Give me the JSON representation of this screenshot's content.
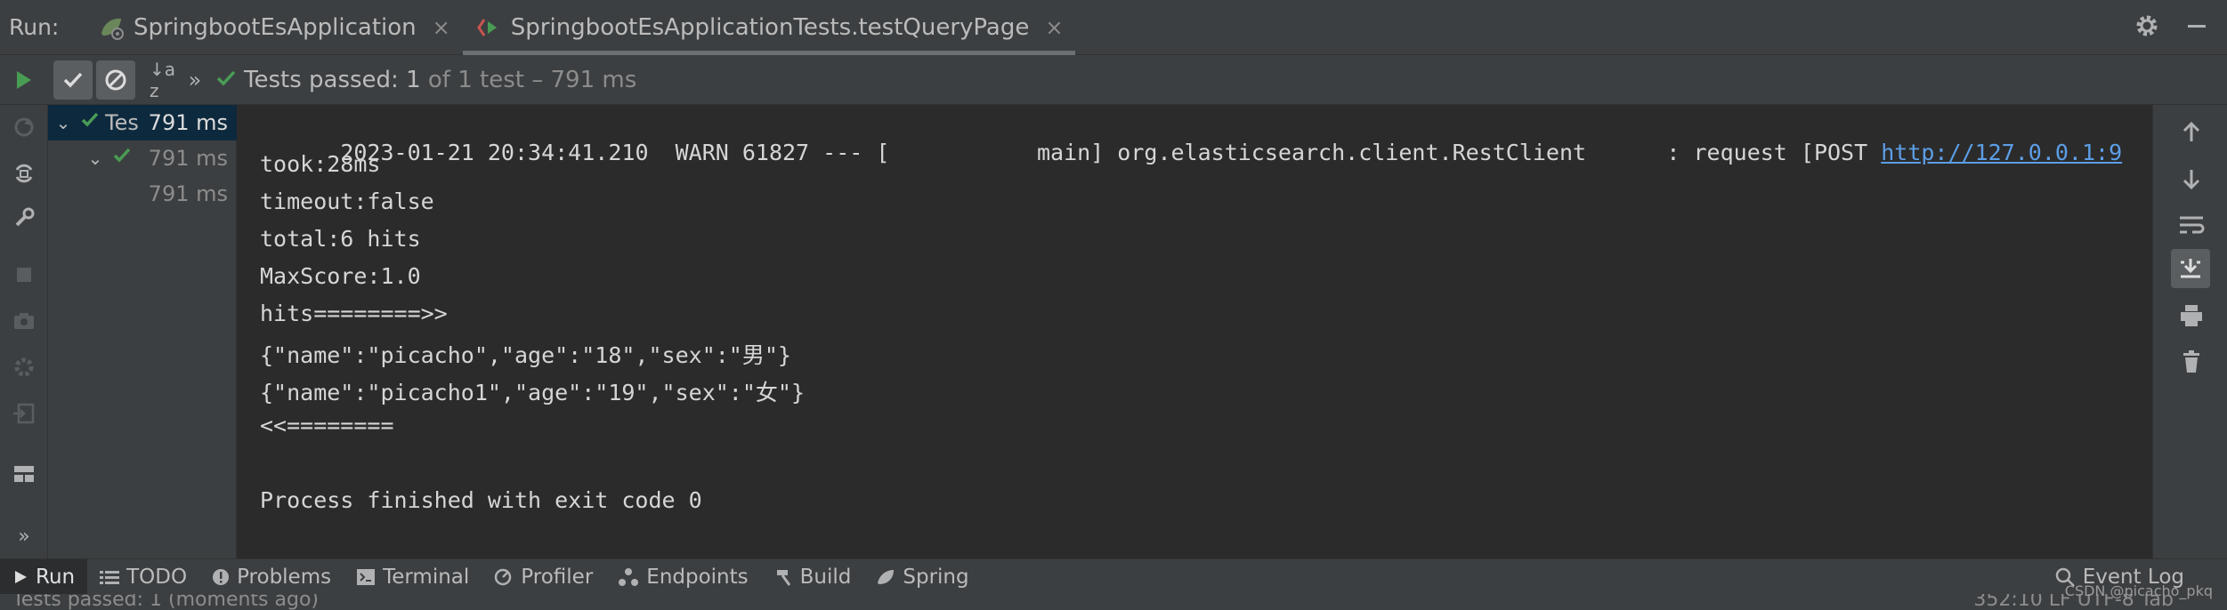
{
  "tabbar": {
    "run_label": "Run:",
    "tabs": [
      {
        "label": "SpringbootEsApplication",
        "close": "×"
      },
      {
        "label": "SpringbootEsApplicationTests.testQueryPage",
        "close": "×"
      }
    ]
  },
  "toolbar": {
    "sort_symbol": "↓a z",
    "more_symbol": "»",
    "status_prefix": "Tests passed:",
    "status_count": "1",
    "status_rest": "of 1 test – 791 ms"
  },
  "tree": {
    "rows": [
      {
        "name": "Tes",
        "time": "791 ms"
      },
      {
        "name": "",
        "time": "791 ms"
      },
      {
        "name": "",
        "time": "791 ms"
      }
    ]
  },
  "console": {
    "log_line_text": "2023-01-21 20:34:41.210  WARN 61827 --- [           main] org.elasticsearch.client.RestClient      : request [POST ",
    "log_line_link": "http://127.0.0.1:9",
    "lines": [
      "took:28ms",
      "timeout:false",
      "total:6 hits",
      "MaxScore:1.0",
      "hits========>>",
      "{\"name\":\"picacho\",\"age\":\"18\",\"sex\":\"男\"}",
      "{\"name\":\"picacho1\",\"age\":\"19\",\"sex\":\"女\"}",
      "<<========",
      "",
      "Process finished with exit code 0"
    ]
  },
  "bottombar": {
    "items": [
      "Run",
      "TODO",
      "Problems",
      "Terminal",
      "Profiler",
      "Endpoints",
      "Build",
      "Spring"
    ],
    "event_log": "Event Log"
  },
  "statusbar": {
    "left_text": "Tests passed: 1 (moments ago)",
    "right_text": "352:10  LF  UTF-8  Tab"
  },
  "watermark": "CSDN @picacho_pkq",
  "colors": {
    "accent_green": "#499c54",
    "link_blue": "#5c9ee6",
    "bg_console": "#2b2b2b",
    "bg_panel": "#3c3f41"
  }
}
